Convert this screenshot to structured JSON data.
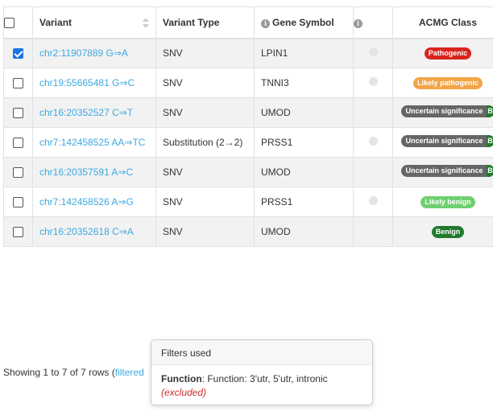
{
  "table": {
    "headers": {
      "variant": "Variant",
      "variant_type": "Variant Type",
      "gene_symbol": "Gene Symbol",
      "acmg_class": "ACMG Class"
    },
    "rows": [
      {
        "checked": true,
        "variant": "chr2:11907889 G⇒A",
        "type": "SNV",
        "gene": "LPIN1",
        "dot": true,
        "acmg": "Pathogenic",
        "acmg_kind": "pathogenic"
      },
      {
        "checked": false,
        "variant": "chr19:55665481 G⇒C",
        "type": "SNV",
        "gene": "TNNI3",
        "dot": true,
        "acmg": "Likely pathogenic",
        "acmg_kind": "likely-pathogenic"
      },
      {
        "checked": false,
        "variant": "chr16:20352527 C⇒T",
        "type": "SNV",
        "gene": "UMOD",
        "dot": false,
        "acmg": "Uncertain significance",
        "acmg_kind": "vus",
        "acmg_tag": "B"
      },
      {
        "checked": false,
        "variant": "chr7:142458525 AA⇒TC",
        "type": "Substitution (2→2)",
        "gene": "PRSS1",
        "dot": true,
        "acmg": "Uncertain significance",
        "acmg_kind": "vus",
        "acmg_tag": "B"
      },
      {
        "checked": false,
        "variant": "chr16:20357591 A⇒C",
        "type": "SNV",
        "gene": "UMOD",
        "dot": false,
        "acmg": "Uncertain significance",
        "acmg_kind": "vus",
        "acmg_tag": "B"
      },
      {
        "checked": false,
        "variant": "chr7:142458526 A⇒G",
        "type": "SNV",
        "gene": "PRSS1",
        "dot": true,
        "acmg": "Likely benign",
        "acmg_kind": "likely-benign"
      },
      {
        "checked": false,
        "variant": "chr16:20352618 C⇒A",
        "type": "SNV",
        "gene": "UMOD",
        "dot": false,
        "acmg": "Benign",
        "acmg_kind": "benign"
      }
    ]
  },
  "footer": {
    "showing": "Showing 1 to 7 of 7 rows (",
    "filtered": "filtered",
    "trail": " "
  },
  "popover": {
    "title": "Filters used",
    "label": "Function",
    "value": ": Function: 3'utr, 5'utr, intronic",
    "excluded": "(excluded)"
  },
  "colors": {
    "link": "#3ea8e0",
    "pathogenic": "#d9241b",
    "likely_pathogenic": "#f3a447",
    "uncertain": "#666666",
    "likely_benign": "#6fcf6f",
    "benign": "#1f7a2b",
    "checkbox_checked": "#1a73e8"
  }
}
